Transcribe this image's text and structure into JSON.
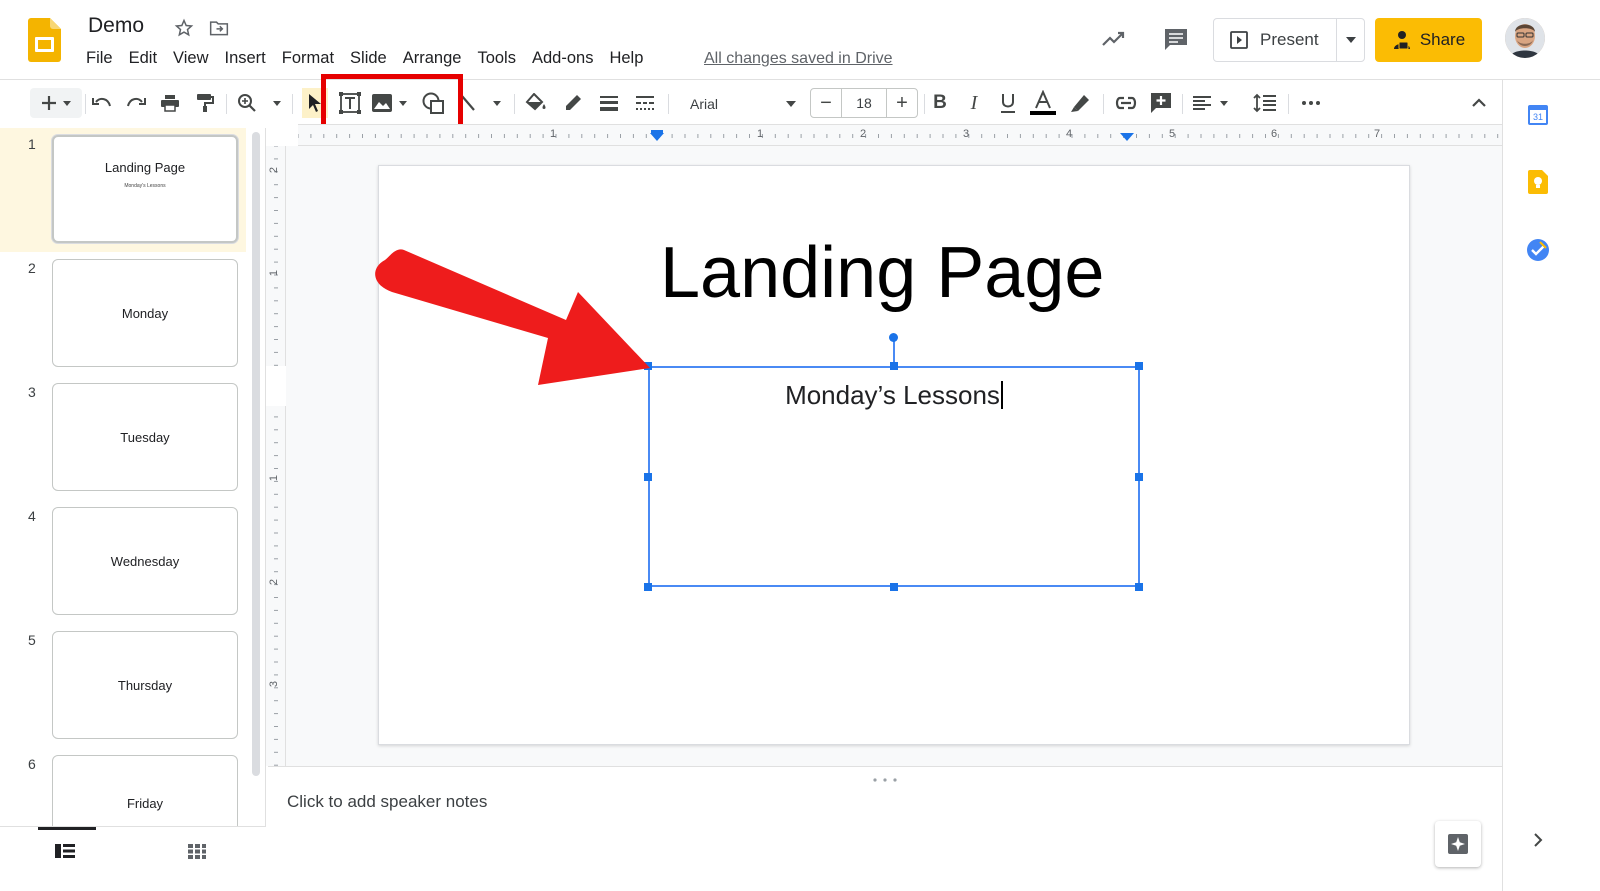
{
  "app": {
    "doc_title": "Demo",
    "menu": [
      "File",
      "Edit",
      "View",
      "Insert",
      "Format",
      "Slide",
      "Arrange",
      "Tools",
      "Add-ons",
      "Help"
    ],
    "save_status": "All changes saved in Drive"
  },
  "header": {
    "present_label": "Present",
    "share_label": "Share",
    "brand_color": "#fbbc04"
  },
  "toolbar": {
    "font_name": "Arial",
    "font_size": "18",
    "highlighted_group": [
      "text-box-icon",
      "image-icon",
      "shape-icon"
    ],
    "highlight_color": "#e60000"
  },
  "ruler": {
    "h_ticks": [
      "1",
      "1",
      "2",
      "3",
      "4",
      "5",
      "6",
      "7"
    ],
    "v_ticks": [
      "2",
      "1",
      "1",
      "2",
      "3"
    ]
  },
  "slides": [
    {
      "number": "1",
      "title": "Landing Page",
      "subtitle": "Monday's Lessons",
      "selected": true
    },
    {
      "number": "2",
      "title": "Monday"
    },
    {
      "number": "3",
      "title": "Tuesday"
    },
    {
      "number": "4",
      "title": "Wednesday"
    },
    {
      "number": "5",
      "title": "Thursday"
    },
    {
      "number": "6",
      "title": "Friday"
    }
  ],
  "canvas": {
    "title": "Landing Page",
    "textbox_text": "Monday’s Lessons",
    "selection_color": "#1a73e8"
  },
  "notes": {
    "placeholder": "Click to add speaker notes"
  },
  "annotation": {
    "arrow_color": "#ee1c1c"
  }
}
